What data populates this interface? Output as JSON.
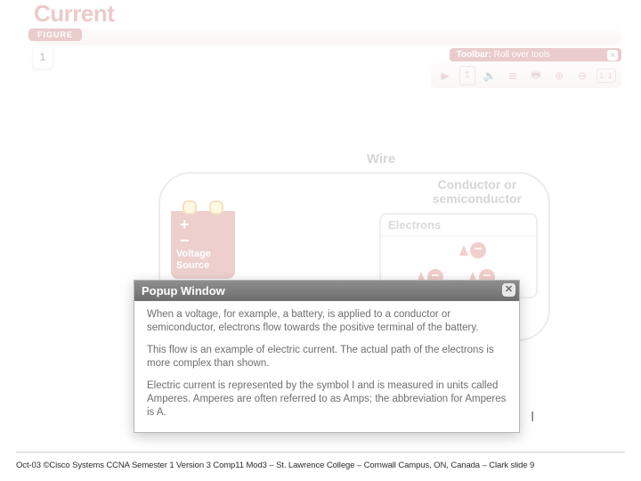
{
  "title": "Current",
  "figure_label": "FIGURE",
  "page_number": "1",
  "toolbar": {
    "label_bold": "Toolbar:",
    "label_rest": " Roll over tools",
    "items": {
      "play": "▶",
      "speaker": "🔈",
      "list": "≣",
      "print": "🖶",
      "zoom_in": "⊕",
      "zoom_out": "⊖",
      "actual_size": "1:1",
      "upload_arrow": "↥"
    }
  },
  "diagram": {
    "wire_title": "Wire",
    "conductor_label_line1": "Conductor or",
    "conductor_label_line2": "semiconductor",
    "electrons_header": "Electrons",
    "battery": {
      "polarity": "+ −",
      "label_line1": "Voltage",
      "label_line2": "Source"
    },
    "minus": "−"
  },
  "popup": {
    "title": "Popup Window",
    "p1": "When a voltage, for example, a battery, is applied to a conductor or semiconductor, electrons flow towards the positive terminal of the battery.",
    "p2": "This flow is an example of electric current. The actual path of the electrons is more complex than shown.",
    "p3": "Electric current is represented by the symbol I and is measured in units called Amperes. Amperes are often referred to as Amps; the abbreviation for Amperes is A."
  },
  "footer": "Oct-03 ©Cisco Systems CCNA Semester 1 Version 3 Comp11 Mod3 – St. Lawrence College – Cornwall Campus, ON, Canada – Clark slide  9"
}
